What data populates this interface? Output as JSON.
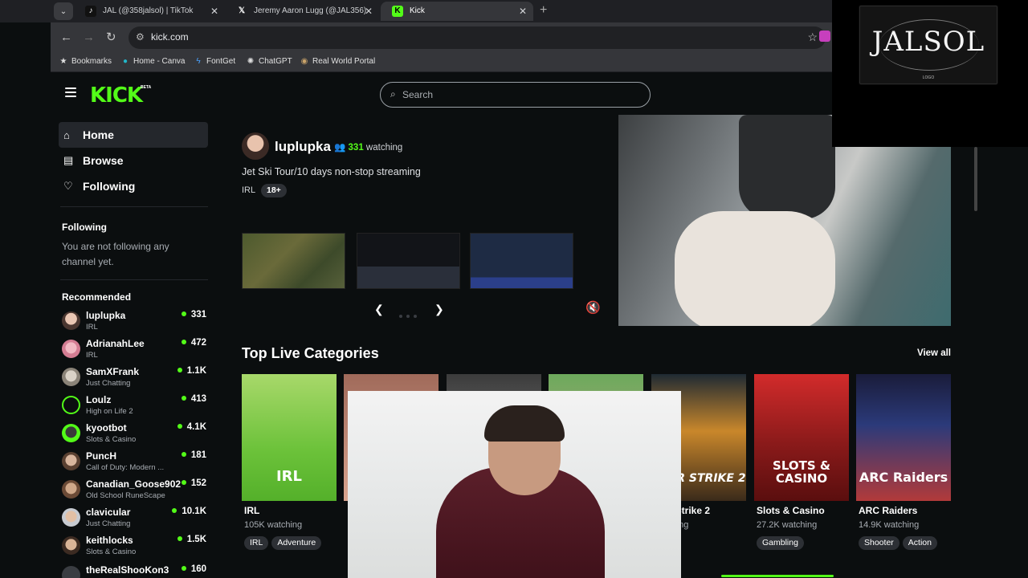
{
  "browser": {
    "tabs": [
      {
        "title": "JAL (@358jalsol) | TikTok",
        "icon": "tiktok-icon",
        "active": false
      },
      {
        "title": "Jeremy Aaron Lugg (@JAL356)",
        "icon": "x-icon",
        "active": false
      },
      {
        "title": "Kick",
        "icon": "kick-icon",
        "active": true
      }
    ],
    "address": "kick.com",
    "bookmarks": [
      {
        "label": "Bookmarks",
        "icon": "star-icon"
      },
      {
        "label": "Home - Canva",
        "icon": "canva-icon"
      },
      {
        "label": "FontGet",
        "icon": "bolt-icon"
      },
      {
        "label": "ChatGPT",
        "icon": "chatgpt-icon"
      },
      {
        "label": "Real World Portal",
        "icon": "portal-icon"
      }
    ]
  },
  "header": {
    "logo": "KICK",
    "logo_badge": "BETA",
    "search_placeholder": "Search"
  },
  "sidebar": {
    "nav": [
      {
        "label": "Home",
        "icon": "home-icon",
        "active": true
      },
      {
        "label": "Browse",
        "icon": "browse-icon",
        "active": false
      },
      {
        "label": "Following",
        "icon": "heart-icon",
        "active": false
      }
    ],
    "following_title": "Following",
    "following_empty": "You are not following any channel yet.",
    "recommended_title": "Recommended",
    "recommended": [
      {
        "name": "luplupka",
        "category": "IRL",
        "viewers": "331"
      },
      {
        "name": "AdrianahLee",
        "category": "IRL",
        "viewers": "472"
      },
      {
        "name": "SamXFrank",
        "category": "Just Chatting",
        "viewers": "1.1K"
      },
      {
        "name": "Loulz",
        "category": "High on Life 2",
        "viewers": "413"
      },
      {
        "name": "kyootbot",
        "category": "Slots & Casino",
        "viewers": "4.1K"
      },
      {
        "name": "PuncH",
        "category": "Call of Duty: Modern ...",
        "viewers": "181"
      },
      {
        "name": "Canadian_Goose902",
        "category": "Old School RuneScape",
        "viewers": "152"
      },
      {
        "name": "clavicular",
        "category": "Just Chatting",
        "viewers": "10.1K"
      },
      {
        "name": "keithlocks",
        "category": "Slots & Casino",
        "viewers": "1.5K"
      },
      {
        "name": "theRealShooKon3",
        "category": "",
        "viewers": "160"
      }
    ]
  },
  "featured": {
    "streamer": "luplupka",
    "viewers": "331",
    "viewers_suffix": "watching",
    "title": "Jet Ski Tour/10 days non-stop streaming",
    "category": "IRL",
    "badge": "18+"
  },
  "categories": {
    "title": "Top Live Categories",
    "view_all": "View all",
    "items": [
      {
        "name": "IRL",
        "watching": "105K watching",
        "tags": [
          "IRL",
          "Adventure"
        ],
        "overlay": "IRL"
      },
      {
        "name": "",
        "watching": "",
        "tags": [],
        "overlay": ""
      },
      {
        "name": "",
        "watching": "",
        "tags": [],
        "overlay": ""
      },
      {
        "name": "",
        "watching": "",
        "tags": [],
        "overlay": ""
      },
      {
        "name": "nter-Strike 2",
        "watching": "watching",
        "tags": [
          "ter"
        ],
        "overlay": "NTER STRIKE 2"
      },
      {
        "name": "Slots & Casino",
        "watching": "27.2K watching",
        "tags": [
          "Gambling"
        ],
        "overlay": "SLOTS & CASINO"
      },
      {
        "name": "ARC Raiders",
        "watching": "14.9K watching",
        "tags": [
          "Shooter",
          "Action"
        ],
        "overlay": "ARC Raiders"
      }
    ]
  },
  "overlay_logo": {
    "text": "JALSOL",
    "subtext": "LOGO"
  },
  "colors": {
    "kick_green": "#53fc18",
    "bg": "#0b0e0f",
    "chrome": "#35363a"
  }
}
